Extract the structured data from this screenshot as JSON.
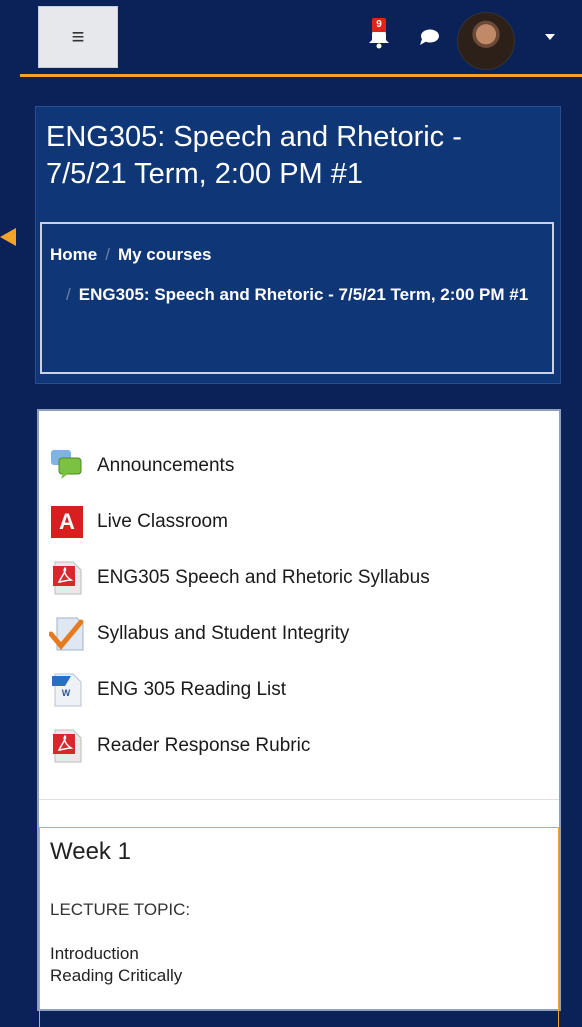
{
  "navbar": {
    "menu_icon": "hamburger-icon",
    "notification_count": "9",
    "notification_icon": "bell-icon",
    "chat_icon": "chat-bubble-icon",
    "accent_color": "#f3a32a",
    "bg_color": "#0a2257"
  },
  "course": {
    "title": "ENG305: Speech and Rhetoric - 7/5/21 Term, 2:00 PM #1"
  },
  "breadcrumb": {
    "home": "Home",
    "separator": "/",
    "my_courses": "My courses",
    "current": "ENG305: Speech and Rhetoric - 7/5/21 Term, 2:00 PM #1"
  },
  "activities": [
    {
      "label": "Announcements",
      "icon": "forum-icon"
    },
    {
      "label": "Live Classroom",
      "icon": "adobe-connect-icon"
    },
    {
      "label": "ENG305 Speech and Rhetoric Syllabus",
      "icon": "pdf-icon"
    },
    {
      "label": "Syllabus and Student Integrity",
      "icon": "checkmark-assignment-icon"
    },
    {
      "label": "ENG 305 Reading List",
      "icon": "word-doc-icon"
    },
    {
      "label": "Reader Response Rubric",
      "icon": "pdf-icon"
    }
  ],
  "week": {
    "title": "Week 1",
    "topic_label": "LECTURE TOPIC:",
    "items": [
      "Introduction",
      "Reading Critically"
    ]
  }
}
